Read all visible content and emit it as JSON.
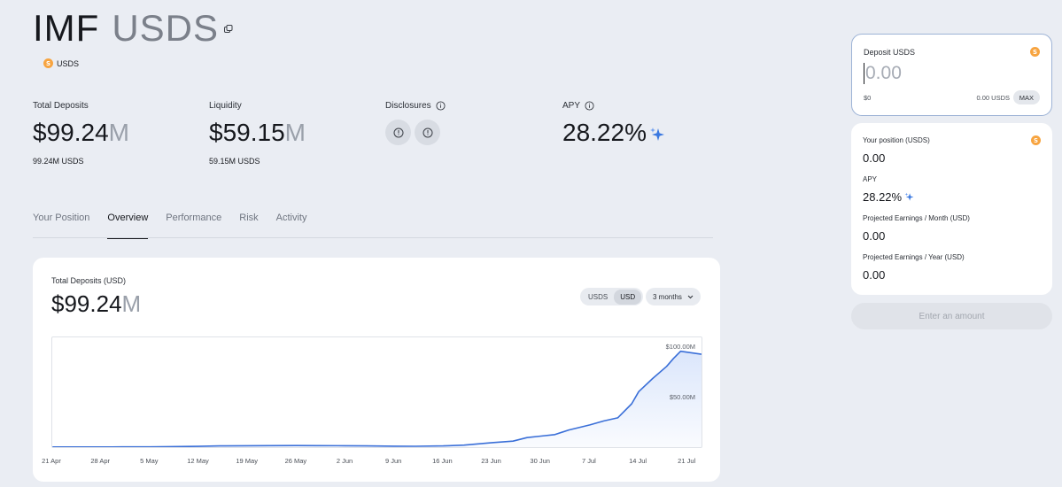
{
  "header": {
    "title": "IMF",
    "symbol": "USDS",
    "token_chip": "USDS",
    "coin_glyph": "S"
  },
  "stats": {
    "total_deposits": {
      "label": "Total Deposits",
      "value": "$99.24",
      "unit": "M",
      "sub": "99.24M USDS"
    },
    "liquidity": {
      "label": "Liquidity",
      "value": "$59.15",
      "unit": "M",
      "sub": "59.15M USDS"
    },
    "disclosures": {
      "label": "Disclosures"
    },
    "apy": {
      "label": "APY",
      "value": "28.22%"
    }
  },
  "tabs": [
    {
      "label": "Your Position",
      "active": false
    },
    {
      "label": "Overview",
      "active": true
    },
    {
      "label": "Performance",
      "active": false
    },
    {
      "label": "Risk",
      "active": false
    },
    {
      "label": "Activity",
      "active": false
    }
  ],
  "chart_card": {
    "label": "Total Deposits (USD)",
    "value": "$99.24",
    "unit": "M",
    "toggle": {
      "options": [
        "USDS",
        "USD"
      ],
      "selected": "USD"
    },
    "range": "3 months"
  },
  "chart_data": {
    "type": "area",
    "x": [
      "21 Apr",
      "23 Apr",
      "25 Apr",
      "28 Apr",
      "1 May",
      "5 May",
      "8 May",
      "12 May",
      "15 May",
      "19 May",
      "22 May",
      "26 May",
      "29 May",
      "2 Jun",
      "5 Jun",
      "9 Jun",
      "12 Jun",
      "16 Jun",
      "19 Jun",
      "23 Jun",
      "26 Jun",
      "28 Jun",
      "30 Jun",
      "2 Jul",
      "4 Jul",
      "7 Jul",
      "9 Jul",
      "11 Jul",
      "13 Jul",
      "14 Jul",
      "16 Jul",
      "18 Jul",
      "19 Jul",
      "20 Jul",
      "21 Jul",
      "23 Jul"
    ],
    "values": [
      0.2,
      0.2,
      0.2,
      0.2,
      0.3,
      0.3,
      0.5,
      0.8,
      1.2,
      1.4,
      1.5,
      1.6,
      1.5,
      1.4,
      1.2,
      1.0,
      0.9,
      1.2,
      2.0,
      4.5,
      6.0,
      9.5,
      11.0,
      12.5,
      17.0,
      22.0,
      26.0,
      29.0,
      43.0,
      55.0,
      68.0,
      80.0,
      88.0,
      95.0,
      94.0,
      92.0
    ],
    "xticks": [
      "21 Apr",
      "28 Apr",
      "5 May",
      "12 May",
      "19 May",
      "26 May",
      "2 Jun",
      "9 Jun",
      "16 Jun",
      "23 Jun",
      "30 Jun",
      "7 Jul",
      "14 Jul",
      "21 Jul"
    ],
    "ylabels": [
      {
        "text": "$100.00M",
        "value": 100
      },
      {
        "text": "$50.00M",
        "value": 50
      }
    ],
    "ylim": [
      0,
      100
    ],
    "title": "",
    "xlabel": "",
    "ylabel": "",
    "grid": false,
    "colors": {
      "line": "#3a6fd8",
      "fill": "#dbe6fb"
    }
  },
  "deposit": {
    "title": "Deposit USDS",
    "placeholder": "0.00",
    "usd_value": "$0",
    "balance": "0.00 USDS",
    "max_label": "MAX"
  },
  "position": {
    "rows": [
      {
        "label": "Your position (USDS)",
        "value": "0.00"
      },
      {
        "label": "APY",
        "value": "28.22%"
      },
      {
        "label": "Projected Earnings / Month (USD)",
        "value": "0.00"
      },
      {
        "label": "Projected Earnings / Year (USD)",
        "value": "0.00"
      }
    ]
  },
  "submit_label": "Enter an amount",
  "colors": {
    "accent": "#3a6fd8",
    "coin": "#f7a440",
    "background": "#eaedf3"
  },
  "icons": {
    "copy": "copy-icon",
    "info": "info-icon",
    "sparkle": "sparkle-icon",
    "coin": "usds-coin-icon",
    "chevron": "chevron-down-icon"
  }
}
